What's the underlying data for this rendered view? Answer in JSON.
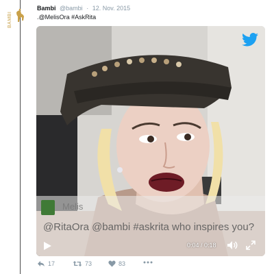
{
  "tweet": {
    "author_name": "Bambi",
    "author_handle": "@bambi",
    "separator": "·",
    "date": "12. Nov. 2015",
    "text": ".@MelisOra #AskRita"
  },
  "avatar": {
    "logo_text": "BAMBI"
  },
  "media": {
    "quoted_tweet": {
      "name": "Melis",
      "text": "@RitaOra @bambi #askrita who inspires you?"
    },
    "player": {
      "time_display": "0:04 / 0:18"
    }
  },
  "actions": {
    "reply_count": "17",
    "retweet_count": "73",
    "like_count": "83"
  },
  "colors": {
    "accent": "#1da1f2",
    "avatar_gold": "#c9a14a",
    "meta_gray": "#8899a6"
  },
  "icons": [
    "reply-icon",
    "retweet-icon",
    "heart-icon",
    "more-icon",
    "twitter-bird-icon",
    "play-icon",
    "volume-icon",
    "fullscreen-icon"
  ]
}
